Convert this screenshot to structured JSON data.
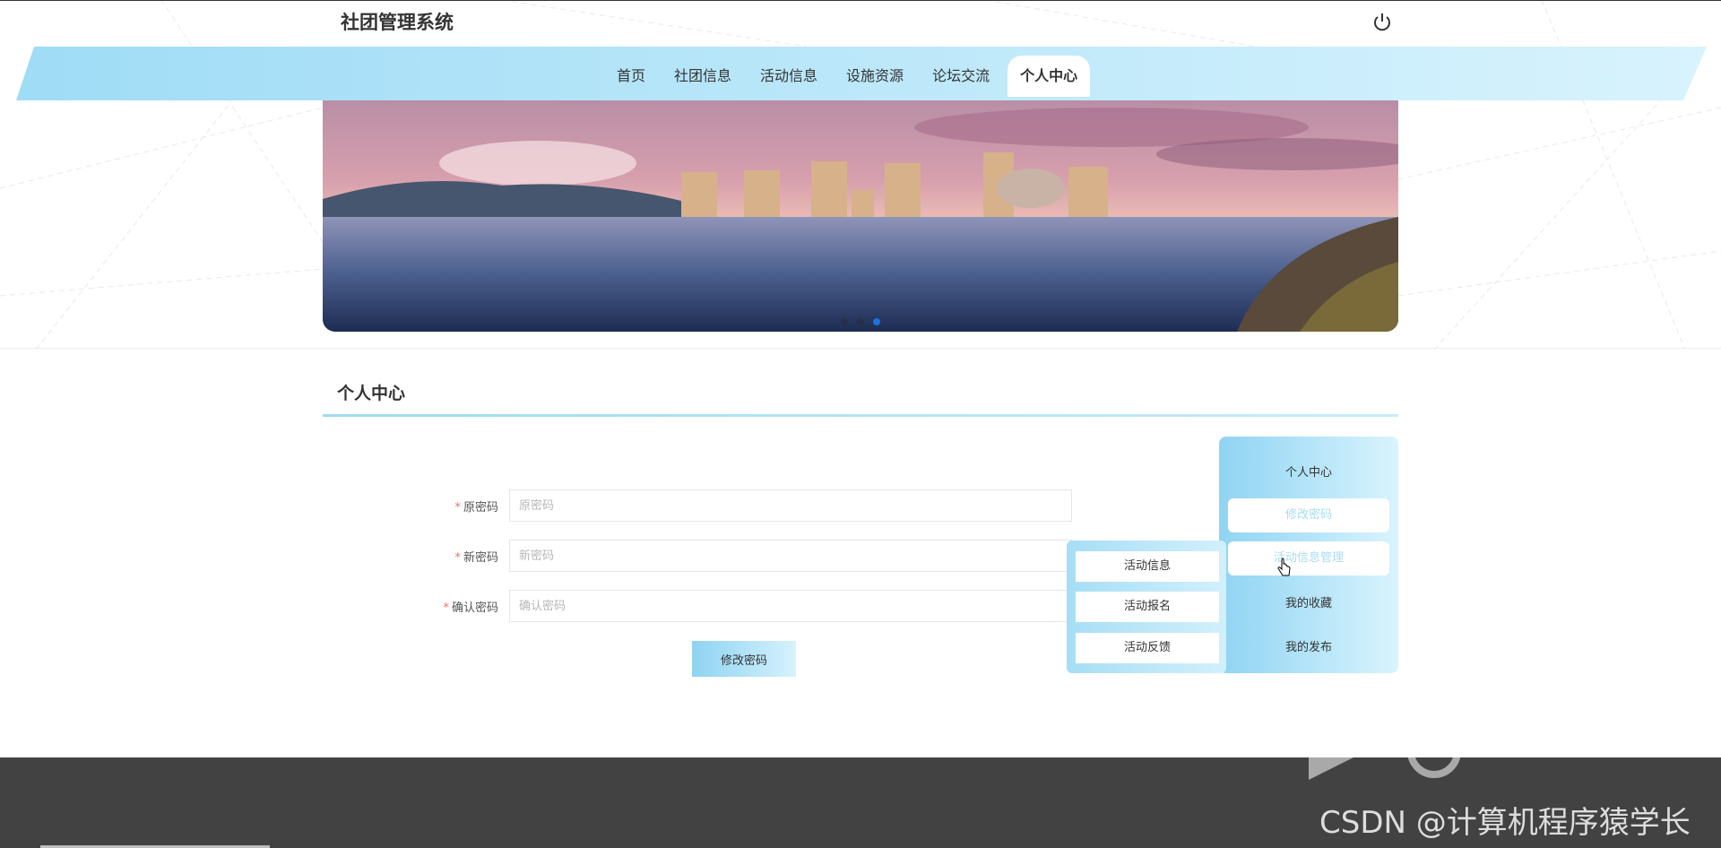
{
  "app": {
    "title": "社团管理系统"
  },
  "header": {
    "power_icon": "power-icon"
  },
  "nav": {
    "items": [
      {
        "label": "首页",
        "active": false
      },
      {
        "label": "社团信息",
        "active": false
      },
      {
        "label": "活动信息",
        "active": false
      },
      {
        "label": "设施资源",
        "active": false
      },
      {
        "label": "论坛交流",
        "active": false
      },
      {
        "label": "个人中心",
        "active": true
      }
    ]
  },
  "carousel": {
    "slides": 3,
    "active_index": 2
  },
  "section": {
    "title": "个人中心"
  },
  "form": {
    "fields": [
      {
        "label": "原密码",
        "required": true,
        "value": "",
        "placeholder": "原密码"
      },
      {
        "label": "新密码",
        "required": true,
        "value": "",
        "placeholder": "新密码"
      },
      {
        "label": "确认密码",
        "required": true,
        "value": "",
        "placeholder": "确认密码"
      }
    ],
    "submit_label": "修改密码"
  },
  "side_menu": {
    "items": [
      {
        "label": "个人中心",
        "highlighted": false
      },
      {
        "label": "修改密码",
        "highlighted": true
      },
      {
        "label": "活动信息管理",
        "highlighted": true
      },
      {
        "label": "我的收藏",
        "highlighted": false
      },
      {
        "label": "我的发布",
        "highlighted": false
      }
    ]
  },
  "sub_menu": {
    "items": [
      {
        "label": "活动信息"
      },
      {
        "label": "活动报名"
      },
      {
        "label": "活动反馈"
      }
    ]
  },
  "watermark": {
    "text": "CSDN @计算机程序猿学长"
  },
  "colors": {
    "nav_gradient_start": "#9fdcf6",
    "nav_gradient_end": "#d8f3fd",
    "active_dot": "#1a74e0",
    "footer": "#424242",
    "required_star": "#f56c6c"
  }
}
